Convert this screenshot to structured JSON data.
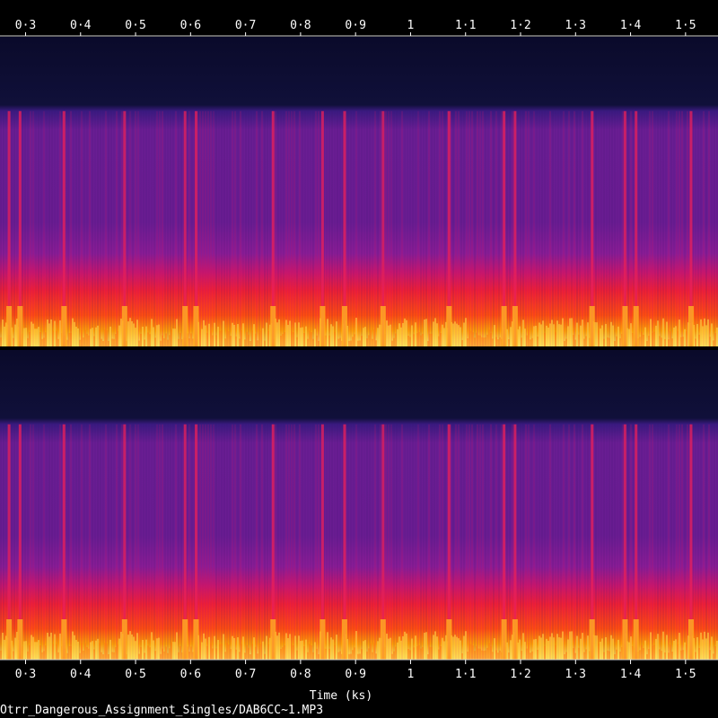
{
  "chart_data": {
    "type": "heatmap",
    "subtype": "audio-spectrogram",
    "channels": 2,
    "xlabel": "Time (ks)",
    "caption": "Otrr_Dangerous_Assignment_Singles/DAB6CC~1.MP3",
    "x_ticks": [
      0.3,
      0.4,
      0.5,
      0.6,
      0.7,
      0.8,
      0.9,
      1.0,
      1.1,
      1.2,
      1.3,
      1.4,
      1.5
    ],
    "x_tick_labels": [
      "0·3",
      "0·4",
      "0·5",
      "0·6",
      "0·7",
      "0·8",
      "0·9",
      "1",
      "1·1",
      "1·2",
      "1·3",
      "1·4",
      "1·5"
    ],
    "xlim": [
      0.2535,
      1.559
    ],
    "colormap": [
      "#0a0a2a",
      "#241a6e",
      "#5a1e8c",
      "#9a1e96",
      "#d4145a",
      "#ff2a10",
      "#ff8a00",
      "#ffe24a",
      "#ffffc8"
    ],
    "energy_profile": {
      "description_levels": [
        "silent top band",
        "purple mid band",
        "red band",
        "yellow low band"
      ],
      "band_fractions": [
        0.24,
        0.52,
        0.17,
        0.07
      ]
    },
    "loud_events_ks": [
      0.27,
      0.29,
      0.37,
      0.48,
      0.59,
      0.61,
      0.75,
      0.84,
      0.88,
      0.95,
      1.07,
      1.17,
      1.19,
      1.33,
      1.39,
      1.41,
      1.51
    ],
    "grid": false
  },
  "colors": {
    "background": "#000000",
    "text": "#ffffff",
    "axis_line": "#cfcfcf",
    "separator": "#000000"
  }
}
